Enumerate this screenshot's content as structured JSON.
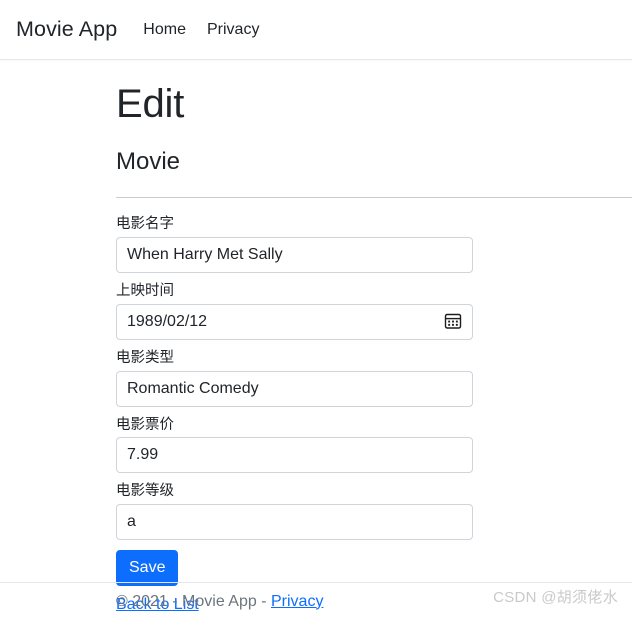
{
  "navbar": {
    "brand": "Movie App",
    "links": [
      {
        "label": "Home"
      },
      {
        "label": "Privacy"
      }
    ]
  },
  "page": {
    "title": "Edit",
    "subtitle": "Movie"
  },
  "form": {
    "fields": [
      {
        "label": "电影名字",
        "value": "When Harry Met Sally",
        "placeholder": "",
        "type": "text"
      },
      {
        "label": "上映时间",
        "value": "1989/02/12",
        "placeholder": "",
        "type": "date",
        "icon": "calendar-icon"
      },
      {
        "label": "电影类型",
        "value": "Romantic Comedy",
        "placeholder": "",
        "type": "text"
      },
      {
        "label": "电影票价",
        "value": "7.99",
        "placeholder": "",
        "type": "text"
      },
      {
        "label": "电影等级",
        "value": "a",
        "placeholder": "",
        "type": "text"
      }
    ],
    "save_label": "Save",
    "back_link": "Back to List"
  },
  "footer": {
    "text": "© 2021 - Movie App - ",
    "link": "Privacy"
  },
  "watermark": "CSDN @胡须佬水",
  "colors": {
    "primary": "#0d6efd",
    "link": "#0d6efd",
    "text": "#212529",
    "muted": "#6c757d",
    "border": "#ced4da"
  }
}
